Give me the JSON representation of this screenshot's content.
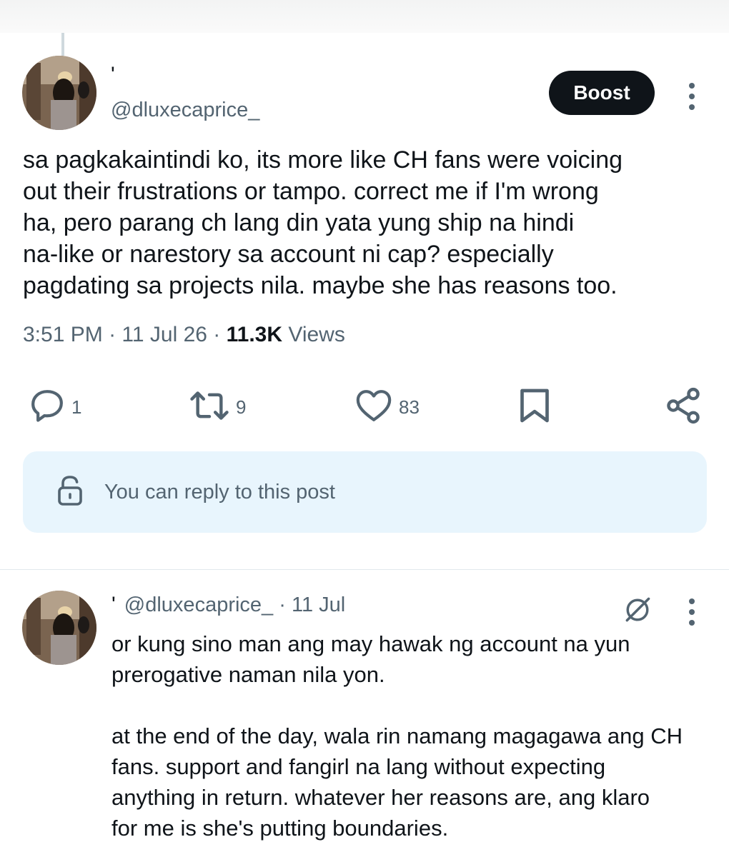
{
  "post": {
    "name_mark": "'",
    "handle": "@dluxecaprice_",
    "boost_label": "Boost",
    "text_lines": [
      "sa pagkakaintindi ko, its more like CH fans  were voicing",
      "out their frustrations or tampo. correct me if I'm wrong",
      "ha, pero parang ch lang din yata yung ship na hindi",
      "na-like or narestory sa account ni cap? especially",
      "pagdating sa projects nila. maybe she has reasons too."
    ],
    "time": "3:51 PM",
    "date": "11 Jul 26",
    "views_count": "11.3K",
    "views_label": "Views",
    "actions": {
      "replies": "1",
      "reposts": "9",
      "likes": "83"
    },
    "reply_permission": "You can reply to this post"
  },
  "reply": {
    "name_mark": "'",
    "handle": "@dluxecaprice_",
    "date": "· 11 Jul",
    "paragraph1": [
      "or kung sino man ang may hawak ng account na yun",
      "prerogative naman nila yon."
    ],
    "paragraph2": [
      "at the end of the day, wala rin namang magagawa ang CH",
      "fans. support and fangirl na lang without expecting",
      "anything in return. whatever her reasons are, ang klaro",
      "for me is she's putting boundaries."
    ]
  },
  "icons": {
    "reply": "comment-icon",
    "repost": "repost-icon",
    "like": "heart-icon",
    "bookmark": "bookmark-icon",
    "share": "share-icon",
    "lock": "unlock-icon",
    "grok": "grok-icon",
    "more": "more-dots-icon"
  },
  "colors": {
    "text": "#0f1419",
    "secondary": "#536471",
    "reply_box_bg": "#e8f5fd",
    "boost_bg": "#0f1419"
  }
}
